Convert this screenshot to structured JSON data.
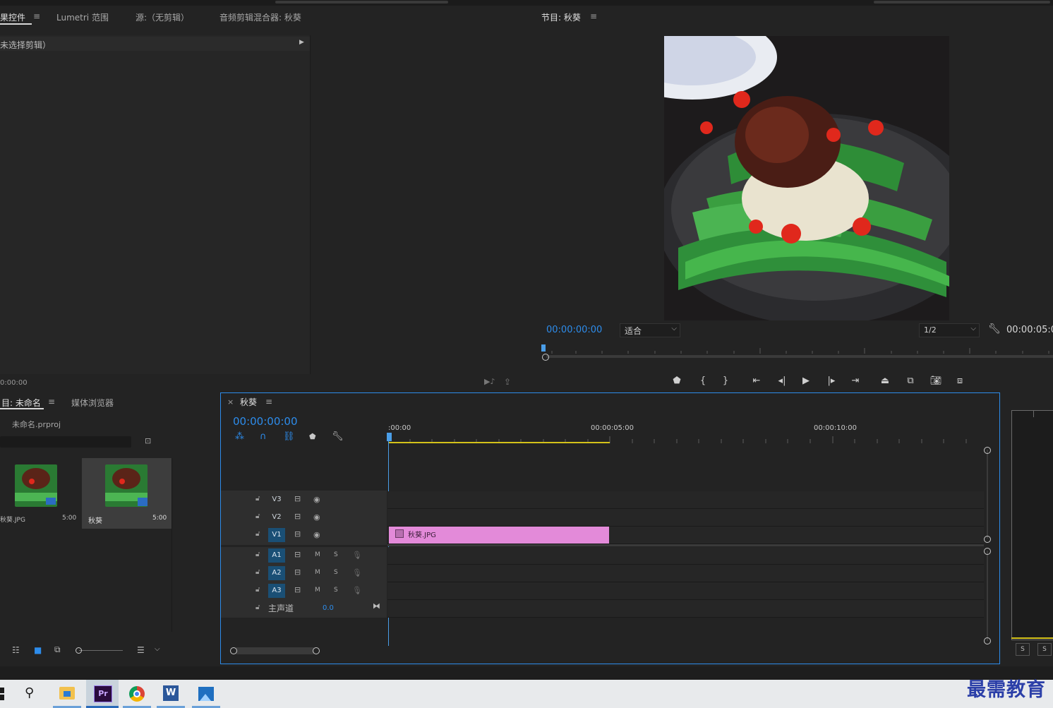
{
  "effect_controls": {
    "tabs": [
      "果控件",
      "Lumetri 范围",
      "源:（无剪辑）",
      "音频剪辑混合器: 秋葵"
    ],
    "menu_icon": "≡",
    "no_clip_text": "未选择剪辑）",
    "timecode": "0:00:00"
  },
  "program_monitor": {
    "title": "节目: 秋葵",
    "menu_icon": "≡",
    "timecode": "00:00:00:00",
    "fit_label": "适合",
    "resolution": "1/2",
    "duration": "00:00:05:0",
    "image_description_icon": "okra-dish-image"
  },
  "project_panel": {
    "tabs": [
      "目: 未命名",
      "媒体浏览器"
    ],
    "menu_icon": "≡",
    "project_file": "未命名.prproj",
    "items": [
      {
        "name": "秋葵.JPG",
        "duration": "5:00"
      },
      {
        "name": "秋葵",
        "duration": "5:00"
      }
    ]
  },
  "timeline": {
    "close_icon": "×",
    "title": "秋葵",
    "menu_icon": "≡",
    "timecode": "00:00:00:00",
    "ruler_labels": [
      ":00:00",
      "00:00:05:00",
      "00:00:10:00"
    ],
    "video_tracks": [
      "V3",
      "V2",
      "V1"
    ],
    "audio_tracks": [
      "A1",
      "A2",
      "A3"
    ],
    "mute_label": "M",
    "solo_label": "S",
    "master_label": "主声道",
    "master_value": "0.0",
    "clip_name": "秋葵.JPG",
    "clip_color": "#e38ad9"
  },
  "audio_meter": {
    "solo_labels": [
      "S",
      "S"
    ]
  },
  "taskbar": {
    "apps": [
      "windows-start",
      "search",
      "file-explorer",
      "premiere-pro",
      "chrome",
      "word",
      "photos"
    ],
    "premiere_label": "Pr",
    "word_label": "W"
  },
  "watermark": "最需教育",
  "colors": {
    "accent_blue": "#2d8ceb",
    "panel_bg": "#232323",
    "clip_pink": "#e38ad9",
    "playhead_blue": "#4a9ee8",
    "work_area_yellow": "#d4c21a"
  }
}
